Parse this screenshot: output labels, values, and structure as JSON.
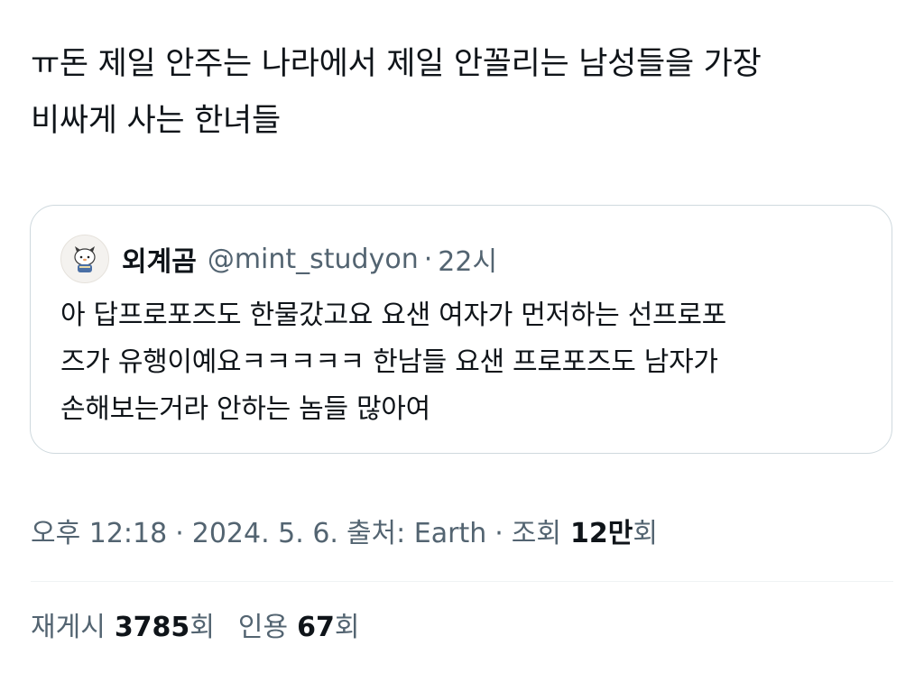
{
  "tweet": {
    "text": "ㅠ돈 제일 안주는 나라에서 제일 안꼴리는 남성들을 가장\n비싸게 사는 한녀들"
  },
  "quote": {
    "author_name": "외계곰",
    "handle": "@mint_studyon",
    "separator": "·",
    "time_ago": "22시",
    "text": "아 답프로포즈도 한물갔고요 요샌 여자가 먼저하는 선프로포\n즈가 유행이예요ㅋㅋㅋㅋㅋ 한남들 요샌 프로포즈도 남자가\n손해보는거라 안하는 놈들 많아여",
    "avatar_icon": "character-avatar-icon"
  },
  "meta": {
    "time": "오후 12:18",
    "date": "2024. 5. 6.",
    "source_label": "출처: Earth",
    "views_label": "조회",
    "views_number": "12만",
    "views_unit": "회",
    "separator": "·"
  },
  "stats": {
    "retweets_label": "재게시",
    "retweets_number": "3785",
    "retweets_unit": "회",
    "quotes_label": "인용",
    "quotes_number": "67",
    "quotes_unit": "회"
  },
  "colors": {
    "text_primary": "#0f1419",
    "text_secondary": "#536471",
    "border": "#cfd9de",
    "divider": "#eff3f4"
  }
}
